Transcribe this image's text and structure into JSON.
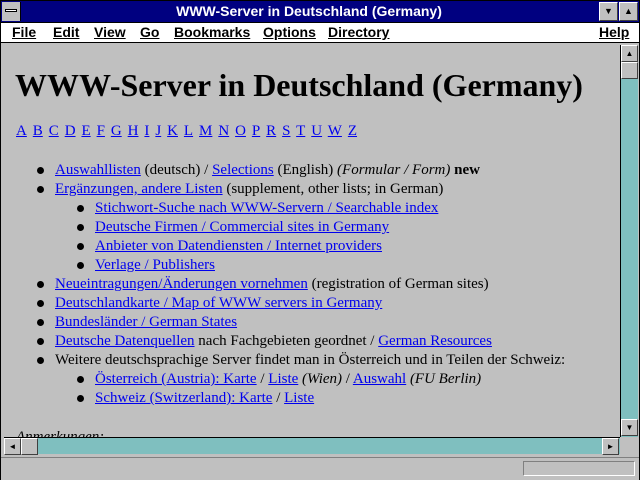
{
  "window": {
    "title": "WWW-Server in Deutschland (Germany)",
    "minimize_symbol": "▼",
    "maximize_symbol": "▲"
  },
  "menubar": {
    "items": [
      {
        "label": "File"
      },
      {
        "label": "Edit"
      },
      {
        "label": "View"
      },
      {
        "label": "Go"
      },
      {
        "label": "Bookmarks"
      },
      {
        "label": "Options"
      },
      {
        "label": "Directory"
      },
      {
        "label": "Help"
      }
    ]
  },
  "page": {
    "heading": "WWW-Server in Deutschland (Germany)",
    "alphabet": [
      "A",
      "B",
      "C",
      "D",
      "E",
      "F",
      "G",
      "H",
      "I",
      "J",
      "K",
      "L",
      "M",
      "N",
      "O",
      "P",
      "R",
      "S",
      "T",
      "U",
      "W",
      "Z"
    ],
    "items": [
      {
        "parts": [
          {
            "t": "Auswahllisten",
            "link": true
          },
          {
            "t": " (deutsch) / "
          },
          {
            "t": "Selections",
            "link": true
          },
          {
            "t": " (English) "
          },
          {
            "t": "(Formular / Form)",
            "italic": true
          },
          {
            "t": " new",
            "bold": true
          }
        ]
      },
      {
        "parts": [
          {
            "t": "Ergänzungen, andere Listen",
            "link": true
          },
          {
            "t": " (supplement, other lists; in German)"
          }
        ]
      },
      {
        "sub": true,
        "parts": [
          {
            "t": "Stichwort-Suche nach WWW-Servern / Searchable index",
            "link": true
          }
        ]
      },
      {
        "sub": true,
        "parts": [
          {
            "t": "Deutsche Firmen / Commercial sites in Germany",
            "link": true
          }
        ]
      },
      {
        "sub": true,
        "parts": [
          {
            "t": "Anbieter von Datendiensten / Internet providers",
            "link": true
          }
        ]
      },
      {
        "sub": true,
        "parts": [
          {
            "t": "Verlage / Publishers",
            "link": true
          }
        ]
      },
      {
        "parts": [
          {
            "t": "Neueintragungen/Änderungen vornehmen",
            "link": true
          },
          {
            "t": " (registration of German sites)"
          }
        ]
      },
      {
        "parts": [
          {
            "t": "Deutschlandkarte / Map of WWW servers in Germany",
            "link": true
          }
        ]
      },
      {
        "parts": [
          {
            "t": "Bundesländer / German States",
            "link": true
          }
        ]
      },
      {
        "parts": [
          {
            "t": "Deutsche Datenquellen",
            "link": true
          },
          {
            "t": " nach Fachgebieten geordnet / "
          },
          {
            "t": "German Resources",
            "link": true
          }
        ]
      },
      {
        "parts": [
          {
            "t": "Weitere deutschsprachige Server findet man in Österreich und in Teilen der Schweiz:"
          }
        ]
      },
      {
        "sub": true,
        "parts": [
          {
            "t": "Österreich (Austria): Karte",
            "link": true
          },
          {
            "t": " / "
          },
          {
            "t": "Liste",
            "link": true
          },
          {
            "t": " (Wien)",
            "italic": true
          },
          {
            "t": " / "
          },
          {
            "t": "Auswahl",
            "link": true
          },
          {
            "t": " (FU Berlin)",
            "italic": true
          }
        ]
      },
      {
        "sub": true,
        "parts": [
          {
            "t": "Schweiz (Switzerland): Karte",
            "link": true
          },
          {
            "t": " / "
          },
          {
            "t": "Liste",
            "link": true
          }
        ]
      }
    ],
    "footer_cut": "Anmerkungen:"
  },
  "scrollbars": {
    "up": "▲",
    "down": "▼",
    "left": "◄",
    "right": "►"
  },
  "status": {
    "text": ""
  }
}
